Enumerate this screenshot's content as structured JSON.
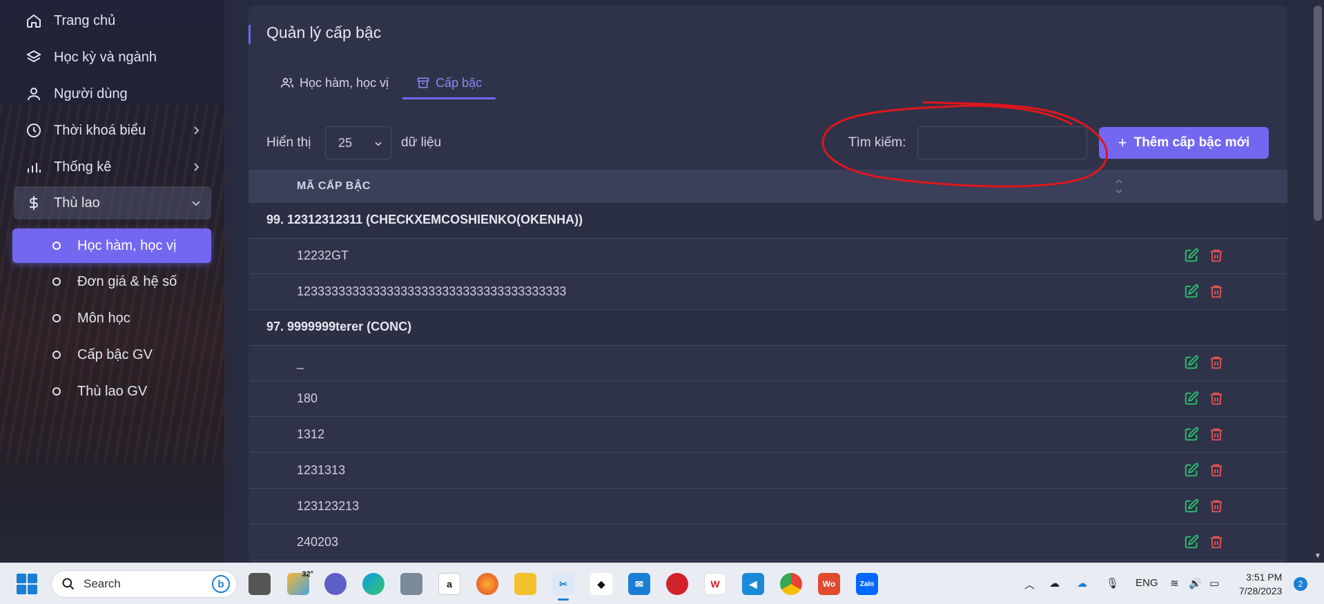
{
  "sidebar": {
    "items": [
      {
        "label": "Trang chủ",
        "icon": "home-icon"
      },
      {
        "label": "Học kỳ và ngành",
        "icon": "layers-icon"
      },
      {
        "label": "Người dùng",
        "icon": "user-icon"
      },
      {
        "label": "Thời khoá biểu",
        "icon": "clock-icon"
      },
      {
        "label": "Thống kê",
        "icon": "bar-chart-icon"
      },
      {
        "label": "Thù lao",
        "icon": "dollar-icon"
      }
    ],
    "sub_items": [
      {
        "label": "Học hàm, học vị",
        "active": true
      },
      {
        "label": "Đơn giá & hệ số"
      },
      {
        "label": "Môn học"
      },
      {
        "label": "Cấp bậc GV"
      },
      {
        "label": "Thù lao GV"
      }
    ]
  },
  "page": {
    "title": "Quản lý cấp bậc",
    "tabs": [
      {
        "label": "Học hàm, học vị",
        "icon": "users-icon"
      },
      {
        "label": "Cấp bậc",
        "icon": "archive-icon",
        "active": true
      }
    ]
  },
  "controls": {
    "show_label": "Hiển thị",
    "page_size": "25",
    "data_label": "dữ liệu",
    "search_label": "Tìm kiếm:",
    "search_value": "",
    "add_button": "Thêm cấp bậc mới"
  },
  "table": {
    "column_header": "MÃ CẤP BẬC",
    "rows": [
      {
        "type": "group",
        "text": "99. 12312312311 (CHECKXEMCOSHIENKO(OKENHA))"
      },
      {
        "type": "item",
        "text": "12232GT"
      },
      {
        "type": "item",
        "text": "123333333333333333333333333333333333333"
      },
      {
        "type": "group",
        "text": "97. 9999999terer (CONC)"
      },
      {
        "type": "item",
        "text": "_"
      },
      {
        "type": "item",
        "text": "180"
      },
      {
        "type": "item",
        "text": "1312"
      },
      {
        "type": "item",
        "text": "1231313"
      },
      {
        "type": "item",
        "text": "123123213"
      },
      {
        "type": "item",
        "text": "240203"
      }
    ]
  },
  "taskbar": {
    "search_label": "Search",
    "weather": "32°",
    "language": "ENG",
    "time": "3:51 PM",
    "date": "7/28/2023",
    "notifications": "2"
  },
  "colors": {
    "accent": "#7367f0",
    "edit": "#28c76f",
    "delete": "#ea5455",
    "annotation": "#e0161b"
  }
}
